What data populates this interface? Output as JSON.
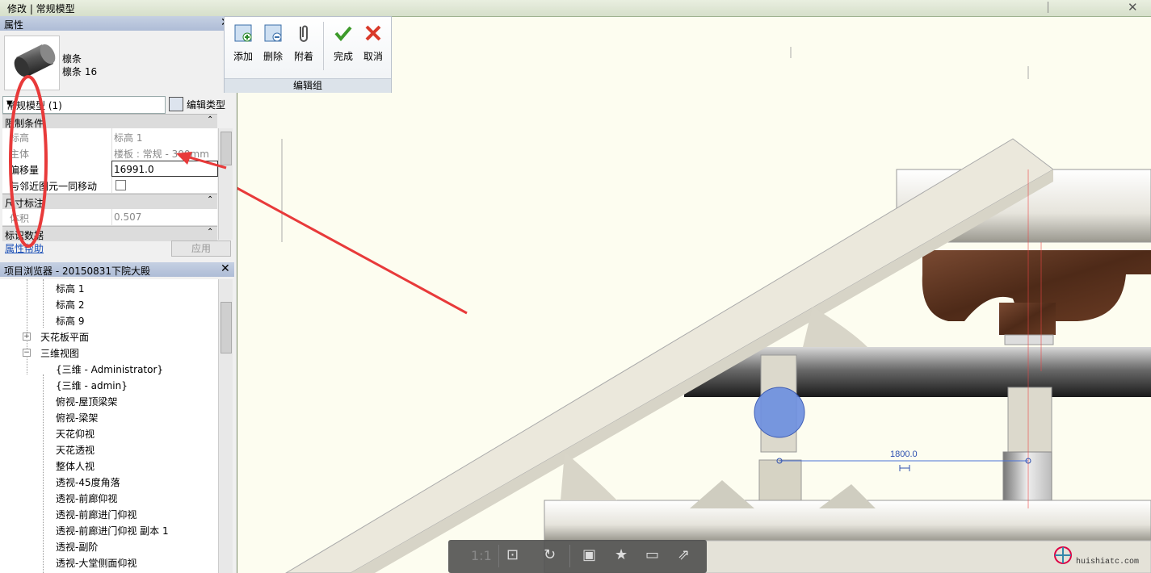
{
  "window": {
    "title": "修改 | 常规模型"
  },
  "properties": {
    "title": "属性",
    "type_name": "檩条",
    "type_sub": "檩条 16",
    "selector_value": "常规模型 (1)",
    "edit_type_label": "编辑类型",
    "sections": [
      {
        "label": "限制条件"
      },
      {
        "label": "尺寸标注"
      },
      {
        "label": "标识数据"
      }
    ],
    "rows": [
      {
        "label": "标高",
        "value": "标高 1"
      },
      {
        "label": "主体",
        "value": "楼板 : 常规 - 300mm"
      },
      {
        "label": "偏移量",
        "value": "16991.0"
      },
      {
        "label": "与邻近图元一同移动",
        "value": ""
      },
      {
        "label": "体积",
        "value": "0.507"
      }
    ],
    "help_label": "属性帮助",
    "apply_label": "应用"
  },
  "browser": {
    "title": "项目浏览器 - 20150831下院大殿",
    "items": [
      "标高 1",
      "标高 2",
      "标高 9",
      "天花板平面",
      "三维视图",
      "{三维 - Administrator}",
      "{三维 - admin}",
      "俯视-屋顶梁架",
      "俯视-梁架",
      "天花仰视",
      "天花透视",
      "整体人视",
      "透视-45度角落",
      "透视-前廊仰视",
      "透视-前廊进门仰视",
      "透视-前廊进门仰视 副本 1",
      "透视-副阶",
      "透视-大堂侧面仰视"
    ]
  },
  "ribbon": {
    "buttons": [
      {
        "label": "添加",
        "icon": "add-icon"
      },
      {
        "label": "删除",
        "icon": "delete-icon"
      },
      {
        "label": "附着",
        "icon": "attach-icon"
      },
      {
        "label": "完成",
        "icon": "check-icon"
      },
      {
        "label": "取消",
        "icon": "cancel-icon"
      }
    ],
    "group_label": "编辑组"
  },
  "canvas": {
    "dimension_label": "1800.0"
  },
  "navbar": {
    "scale_label": "1:1"
  },
  "watermark": {
    "text": "huishiatc.com"
  },
  "colors": {
    "accent": "#4a72d8",
    "annotation": "#e83a3a"
  }
}
